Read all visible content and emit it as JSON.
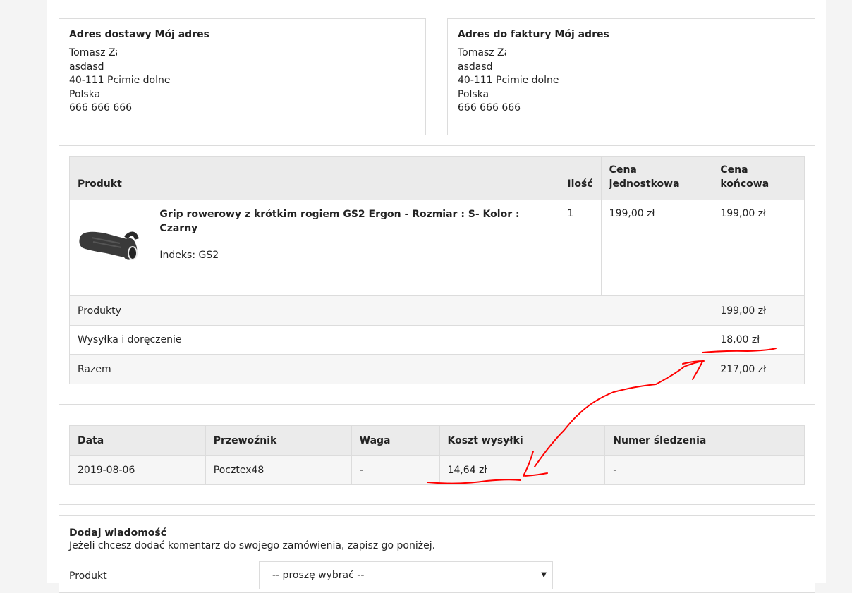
{
  "delivery": {
    "title": "Adres dostawy Mój adres",
    "name": "Tomasz Za",
    "street": "asdasd",
    "city": "40-111 Pcimie dolne",
    "country": "Polska",
    "phone": "666 666 666"
  },
  "invoice": {
    "title": "Adres do faktury Mój adres",
    "name": "Tomasz Za",
    "street": "asdasd",
    "city": "40-111 Pcimie dolne",
    "country": "Polska",
    "phone": "666 666 666"
  },
  "order": {
    "headers": {
      "product": "Produkt",
      "qty": "Ilość",
      "unit_price": "Cena jednostkowa",
      "total_price": "Cena końcowa"
    },
    "item": {
      "name": "Grip rowerowy z krótkim rogiem GS2 Ergon - Rozmiar : S- Kolor : Czarny",
      "index": "Indeks: GS2",
      "qty": "1",
      "unit_price": "199,00 zł",
      "total_price": "199,00 zł"
    },
    "summary": [
      {
        "label": "Produkty",
        "value": "199,00 zł"
      },
      {
        "label": "Wysyłka i doręczenie",
        "value": "18,00 zł"
      },
      {
        "label": "Razem",
        "value": "217,00 zł"
      }
    ]
  },
  "shipping": {
    "headers": {
      "date": "Data",
      "carrier": "Przewoźnik",
      "weight": "Waga",
      "cost": "Koszt wysyłki",
      "tracking": "Numer śledzenia"
    },
    "row": {
      "date": "2019-08-06",
      "carrier": "Pocztex48",
      "weight": "-",
      "cost": "14,64 zł",
      "tracking": "-"
    }
  },
  "message": {
    "title": "Dodaj wiadomość",
    "hint": "Jeżeli chcesz dodać komentarz do swojego zamówienia, zapisz go poniżej.",
    "product_label": "Produkt",
    "select_value": "-- proszę wybrać --"
  },
  "colors": {
    "annotation": "#ff0000",
    "header_bg": "#ebebeb",
    "border": "#dcdcdc"
  }
}
